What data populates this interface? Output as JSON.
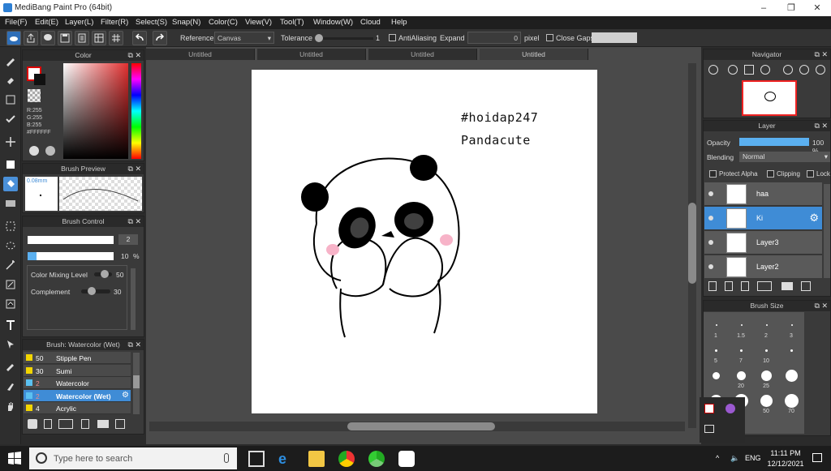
{
  "window": {
    "title": "MediBang Paint Pro (64bit)",
    "controls": [
      "–",
      "❐",
      "✕"
    ]
  },
  "menu": [
    "File(F)",
    "Edit(E)",
    "Layer(L)",
    "Filter(R)",
    "Select(S)",
    "Snap(N)",
    "Color(C)",
    "View(V)",
    "Tool(T)",
    "Window(W)",
    "Cloud",
    "Help"
  ],
  "toolbar": {
    "reference_label": "Reference",
    "reference_value": "Canvas",
    "tolerance_label": "Tolerance",
    "tolerance_value": "1",
    "antialiasing_label": "AntiAliasing",
    "expand_label": "Expand",
    "expand_value": "0",
    "expand_unit": "pixel",
    "close_gaps_label": "Close Gaps"
  },
  "color_panel": {
    "title": "Color",
    "r": "R:255",
    "g": "G:255",
    "b": "B:255",
    "hex": "#FFFFFF"
  },
  "brush_preview": {
    "title": "Brush Preview",
    "size": "0.08mm"
  },
  "brush_control": {
    "title": "Brush Control",
    "size_value": "2",
    "opacity_value": "10",
    "opacity_unit": "%",
    "mixing_label": "Color Mixing Level",
    "mixing_value": "50",
    "complement_label": "Complement",
    "complement_value": "30"
  },
  "brush_list": {
    "title": "Brush: Watercolor (Wet)",
    "items": [
      {
        "size": "50",
        "name": "Stipple Pen",
        "color": "#f2d500"
      },
      {
        "size": "30",
        "name": "Sumi",
        "color": "#f2d500"
      },
      {
        "size": "2",
        "name": "Watercolor",
        "color": "#5bc0f0"
      },
      {
        "size": "2",
        "name": "Watercolor (Wet)",
        "color": "#5bc0f0"
      },
      {
        "size": "4",
        "name": "Acrylic",
        "color": "#f2d500"
      }
    ],
    "selected_index": 3
  },
  "tabs": [
    "Untitled",
    "Untitled",
    "Untitled",
    "Untitled"
  ],
  "canvas_text": {
    "tag": "#hoidap247",
    "caption": "Pandacute"
  },
  "navigator": {
    "title": "Navigator"
  },
  "layer_panel": {
    "title": "Layer",
    "opacity_label": "Opacity",
    "opacity_value": "100 %",
    "blending_label": "Blending",
    "blending_value": "Normal",
    "protect_alpha": "Protect Alpha",
    "clipping": "Clipping",
    "lock": "Lock",
    "layers": [
      "haa",
      "Ki",
      "Layer3",
      "Layer2"
    ],
    "selected_index": 1
  },
  "brush_size": {
    "title": "Brush Size",
    "labels": [
      "1",
      "1.5",
      "2",
      "3",
      "5",
      "7",
      "10",
      "20",
      "25",
      "50",
      "70"
    ]
  },
  "taskbar": {
    "search_placeholder": "Type here to search",
    "lang": "ENG",
    "time": "11:11 PM",
    "date": "12/12/2021"
  },
  "colors": {
    "accent": "#3f8cd6",
    "panel": "#3a3a3a",
    "dark": "#2b2b2b"
  }
}
